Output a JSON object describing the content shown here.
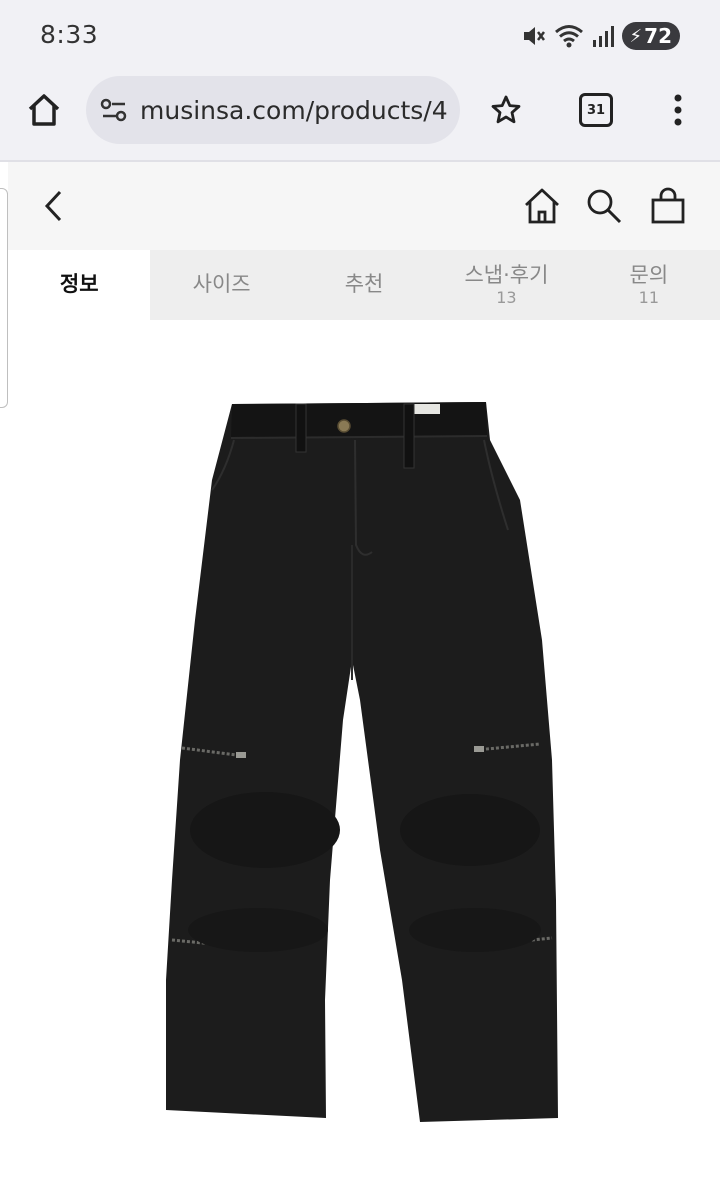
{
  "status": {
    "time": "8:33",
    "battery": "72",
    "icons": [
      "mute-icon",
      "wifi-icon",
      "signal-icon",
      "battery-icon"
    ]
  },
  "browser": {
    "url": "musinsa.com/products/4",
    "tab_count": "31",
    "icons": [
      "home-icon",
      "site-settings-icon",
      "bookmark-star-icon",
      "tab-switcher-icon",
      "more-menu-icon"
    ]
  },
  "app_header": {
    "icons": [
      "back-icon",
      "home-icon",
      "search-icon",
      "shopping-bag-icon"
    ]
  },
  "tabs": [
    {
      "label": "정보",
      "count": "",
      "active": true
    },
    {
      "label": "사이즈",
      "count": "",
      "active": false
    },
    {
      "label": "추천",
      "count": "",
      "active": false
    },
    {
      "label": "스냅·후기",
      "count": "13",
      "active": false
    },
    {
      "label": "문의",
      "count": "11",
      "active": false
    }
  ],
  "product": {
    "image_subject": "black wide pants with knee zippers"
  },
  "colors": {
    "browser_bg": "#f1f1f5",
    "omnibox_bg": "#e3e3ea",
    "tab_bar_bg": "#eeeeee",
    "product_color": "#1c1c1c"
  }
}
